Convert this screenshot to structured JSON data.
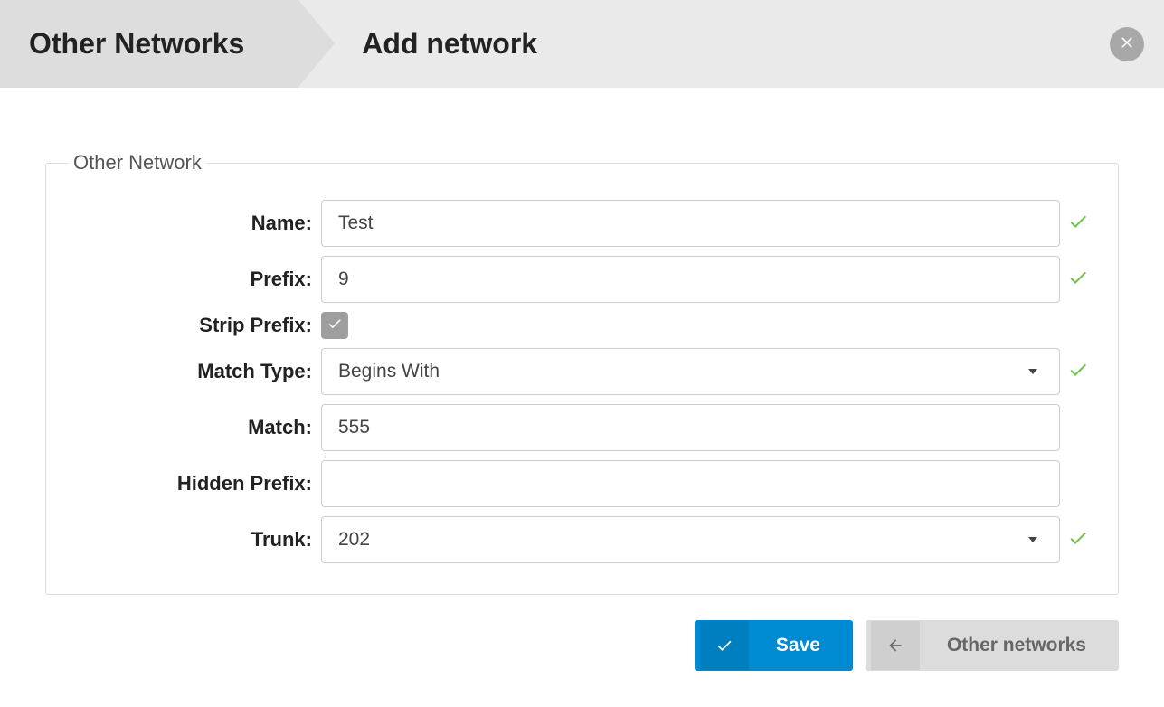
{
  "header": {
    "crumb1": "Other Networks",
    "crumb2": "Add network"
  },
  "group": {
    "legend": "Other Network"
  },
  "fields": {
    "name": {
      "label": "Name:",
      "value": "Test",
      "valid": true
    },
    "prefix": {
      "label": "Prefix:",
      "value": "9",
      "valid": true
    },
    "stripPrefix": {
      "label": "Strip Prefix:",
      "checked": true
    },
    "matchType": {
      "label": "Match Type:",
      "value": "Begins With",
      "valid": true
    },
    "match": {
      "label": "Match:",
      "value": "555"
    },
    "hiddenPrefix": {
      "label": "Hidden Prefix:",
      "value": ""
    },
    "trunk": {
      "label": "Trunk:",
      "value": "202",
      "valid": true
    }
  },
  "actions": {
    "save": "Save",
    "back": "Other networks"
  }
}
